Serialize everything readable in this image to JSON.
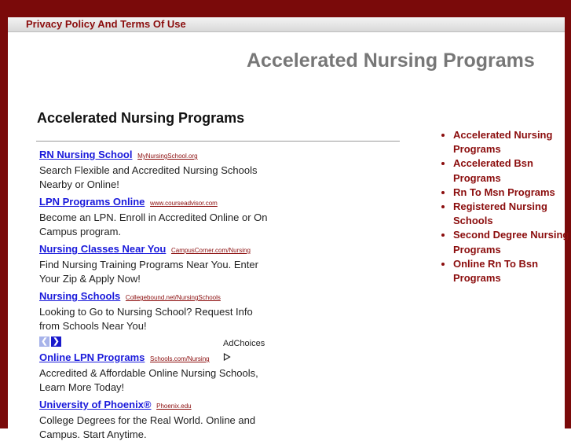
{
  "colors": {
    "frame": "#7a0a0a",
    "link_red": "#8b0d0d",
    "ad_blue": "#1a1adb"
  },
  "topbar": {
    "privacy_link": "Privacy Policy And Terms Of Use"
  },
  "header": {
    "site_title": "Accelerated Nursing Programs"
  },
  "main": {
    "title": "Accelerated Nursing Programs",
    "ads": [
      {
        "title": "RN Nursing School",
        "url": "MyNursingSchool.org",
        "desc": "Search Flexible and Accredited Nursing Schools Nearby or Online!"
      },
      {
        "title": "LPN Programs Online",
        "url": "www.courseadvisor.com",
        "desc": "Become an LPN. Enroll in Accredited Online or On Campus program."
      },
      {
        "title": "Nursing Classes Near You",
        "url": "CampusCorner.com/Nursing",
        "desc": "Find Nursing Training Programs Near You. Enter Your Zip & Apply Now!"
      },
      {
        "title": "Nursing Schools",
        "url": "Collegebound.net/NursingSchools",
        "desc": "Looking to Go to Nursing School? Request Info from Schools Near You!"
      },
      {
        "title": "Online LPN Programs",
        "url": "Schools.com/Nursing",
        "desc": "Accredited & Affordable Online Nursing Schools, Learn More Today!"
      },
      {
        "title": "University of Phoenix®",
        "url": "Phoenix.edu",
        "desc": "College Degrees for the Real World. Online and Campus. Start Anytime."
      }
    ],
    "adchoices_label": "AdChoices",
    "prev_glyph": "❮",
    "next_glyph": "❯",
    "adchoices_icon": "play-triangle-icon"
  },
  "sidebar": {
    "items": [
      {
        "label": "Accelerated Nursing Programs"
      },
      {
        "label": "Accelerated Bsn Programs"
      },
      {
        "label": "Rn To Msn Programs"
      },
      {
        "label": "Registered Nursing Schools"
      },
      {
        "label": "Second Degree Nursing Programs"
      },
      {
        "label": "Online Rn To Bsn Programs"
      }
    ]
  }
}
